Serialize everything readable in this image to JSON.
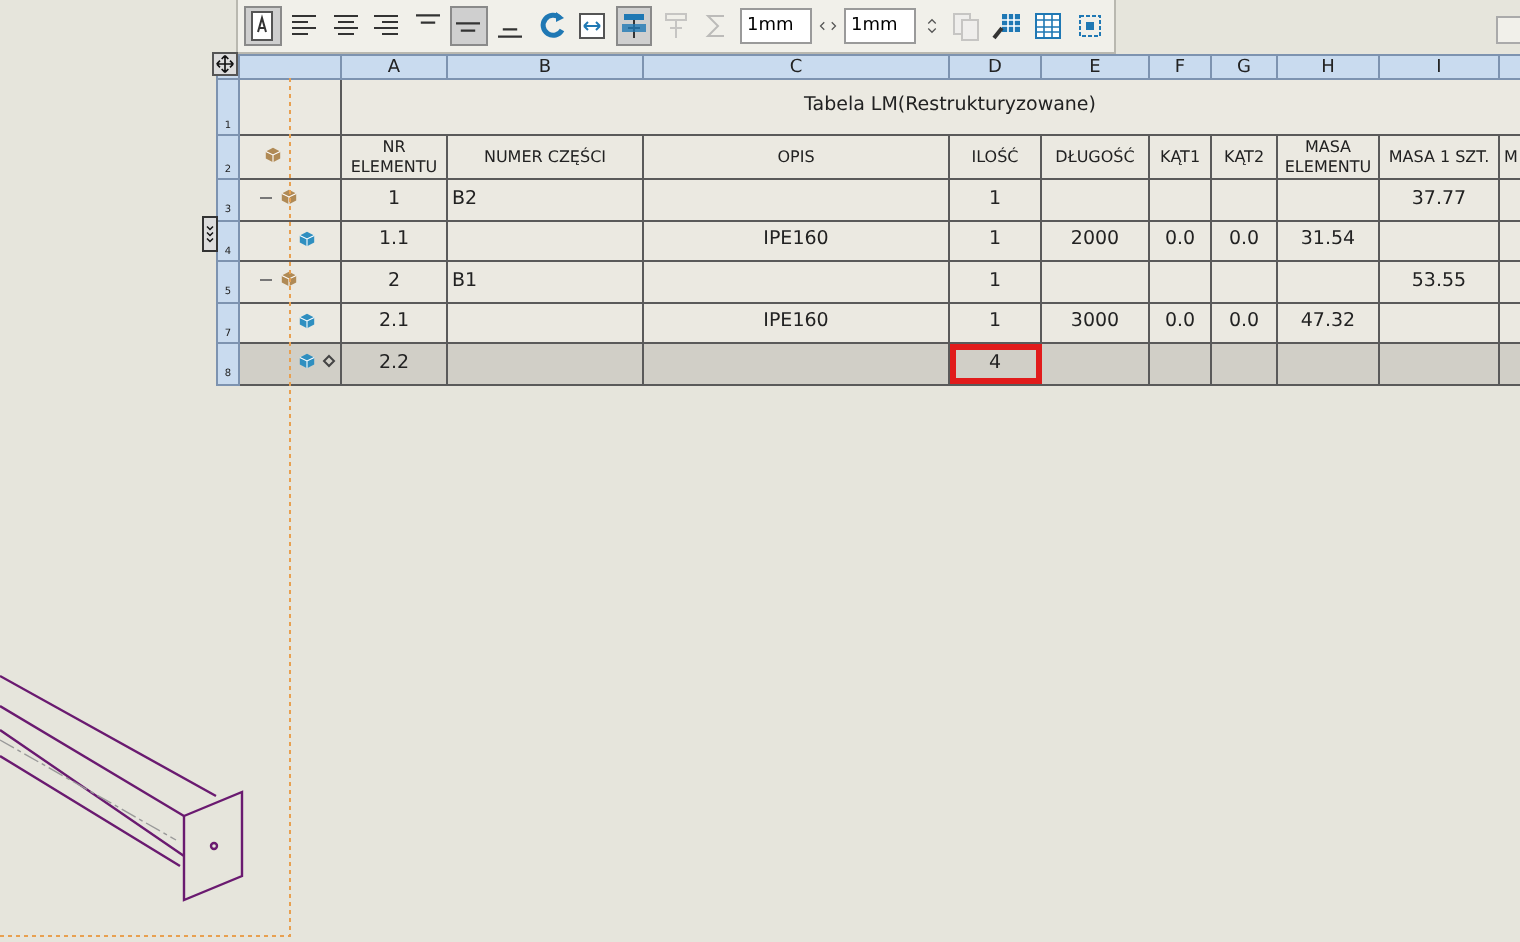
{
  "toolbar": {
    "items": [
      {
        "kind": "text-frame",
        "pressed": true,
        "disabled": false
      },
      {
        "kind": "align-left",
        "pressed": false,
        "disabled": false
      },
      {
        "kind": "align-center",
        "pressed": false,
        "disabled": false
      },
      {
        "kind": "align-right",
        "pressed": false,
        "disabled": false
      },
      {
        "kind": "align-top",
        "pressed": false,
        "disabled": false
      },
      {
        "kind": "align-middle",
        "pressed": true,
        "disabled": false
      },
      {
        "kind": "align-bottom",
        "pressed": false,
        "disabled": false
      },
      {
        "kind": "rotate",
        "pressed": false,
        "disabled": false
      },
      {
        "kind": "fit",
        "pressed": false,
        "disabled": false
      },
      {
        "kind": "header-top",
        "pressed": true,
        "disabled": false
      },
      {
        "kind": "header-bottom",
        "pressed": false,
        "disabled": true
      },
      {
        "kind": "sum",
        "pressed": false,
        "disabled": true
      },
      {
        "kind": "field",
        "value": "1mm"
      },
      {
        "kind": "spin-horizontal",
        "pressed": false,
        "disabled": false
      },
      {
        "kind": "field",
        "value": "1mm"
      },
      {
        "kind": "spin-vertical",
        "pressed": false,
        "disabled": false
      },
      {
        "kind": "copy",
        "pressed": false,
        "disabled": true
      },
      {
        "kind": "table-props",
        "pressed": false,
        "disabled": false
      },
      {
        "kind": "table-grid",
        "pressed": false,
        "disabled": false
      },
      {
        "kind": "select",
        "pressed": false,
        "disabled": false
      }
    ]
  },
  "table": {
    "column_letters": [
      "A",
      "B",
      "C",
      "D",
      "E",
      "F",
      "G",
      "H",
      "I"
    ],
    "title": "Tabela LM(Restrukturyzowane)",
    "title_row_number": "1",
    "header_row_number": "2",
    "columns": [
      "NR ELEMENTU",
      "NUMER CZĘŚCI",
      "OPIS",
      "ILOŚĆ",
      "DŁUGOŚĆ",
      "KĄT1",
      "KĄT2",
      "MASA ELEMENTU",
      "MASA 1 SZT.",
      "M"
    ],
    "rows": [
      {
        "row_number": "3",
        "kind": "assembly",
        "expanded": true,
        "selected": false,
        "cells": [
          {
            "text": "1",
            "highlighted": false
          },
          {
            "text": "B2",
            "highlighted": false
          },
          {
            "text": "",
            "highlighted": false
          },
          {
            "text": "1",
            "highlighted": false
          },
          {
            "text": "",
            "highlighted": false
          },
          {
            "text": "",
            "highlighted": false
          },
          {
            "text": "",
            "highlighted": false
          },
          {
            "text": "",
            "highlighted": false
          },
          {
            "text": "37.77",
            "highlighted": false
          },
          {
            "text": "",
            "highlighted": false
          }
        ]
      },
      {
        "row_number": "4",
        "kind": "part",
        "selected": false,
        "cells": [
          {
            "text": "1.1",
            "highlighted": false
          },
          {
            "text": "",
            "highlighted": false
          },
          {
            "text": "IPE160",
            "highlighted": false
          },
          {
            "text": "1",
            "highlighted": false
          },
          {
            "text": "2000",
            "highlighted": false
          },
          {
            "text": "0.0",
            "highlighted": false
          },
          {
            "text": "0.0",
            "highlighted": false
          },
          {
            "text": "31.54",
            "highlighted": false
          },
          {
            "text": "",
            "highlighted": false
          },
          {
            "text": "",
            "highlighted": false
          }
        ]
      },
      {
        "row_number": "5",
        "kind": "assembly",
        "expanded": true,
        "selected": false,
        "cells": [
          {
            "text": "2",
            "highlighted": false
          },
          {
            "text": "B1",
            "highlighted": false
          },
          {
            "text": "",
            "highlighted": false
          },
          {
            "text": "1",
            "highlighted": false
          },
          {
            "text": "",
            "highlighted": false
          },
          {
            "text": "",
            "highlighted": false
          },
          {
            "text": "",
            "highlighted": false
          },
          {
            "text": "",
            "highlighted": false
          },
          {
            "text": "53.55",
            "highlighted": false
          },
          {
            "text": "",
            "highlighted": false
          }
        ]
      },
      {
        "row_number": "7",
        "kind": "part",
        "selected": false,
        "cells": [
          {
            "text": "2.1",
            "highlighted": false
          },
          {
            "text": "",
            "highlighted": false
          },
          {
            "text": "IPE160",
            "highlighted": false
          },
          {
            "text": "1",
            "highlighted": false
          },
          {
            "text": "3000",
            "highlighted": false
          },
          {
            "text": "0.0",
            "highlighted": false
          },
          {
            "text": "0.0",
            "highlighted": false
          },
          {
            "text": "47.32",
            "highlighted": false
          },
          {
            "text": "",
            "highlighted": false
          },
          {
            "text": "",
            "highlighted": false
          }
        ]
      },
      {
        "row_number": "8",
        "kind": "part-linked",
        "selected": true,
        "cells": [
          {
            "text": "2.2",
            "highlighted": false
          },
          {
            "text": "",
            "highlighted": false
          },
          {
            "text": "",
            "highlighted": false
          },
          {
            "text": "4",
            "highlighted": true
          },
          {
            "text": "",
            "highlighted": false
          },
          {
            "text": "",
            "highlighted": false
          },
          {
            "text": "",
            "highlighted": false
          },
          {
            "text": "",
            "highlighted": false
          },
          {
            "text": "",
            "highlighted": false
          },
          {
            "text": "",
            "highlighted": false
          }
        ]
      }
    ]
  }
}
